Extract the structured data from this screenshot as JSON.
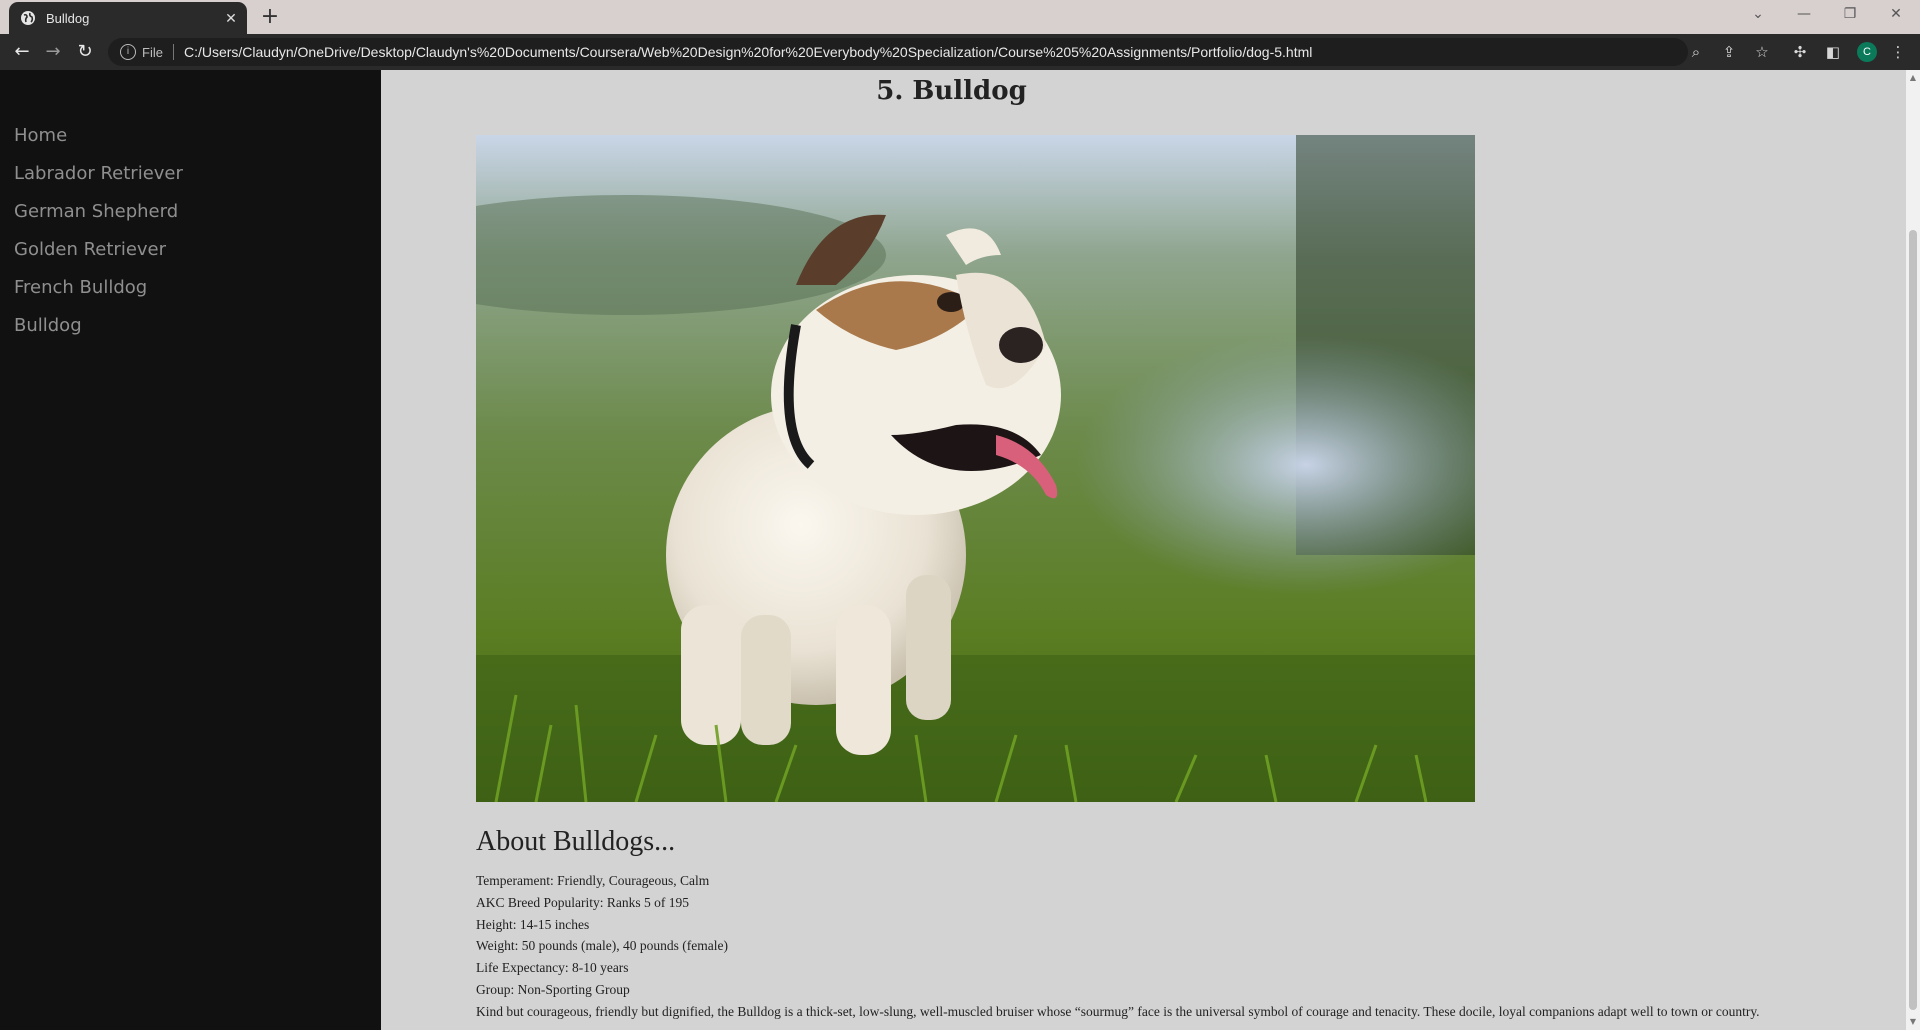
{
  "browser": {
    "tab_title": "Bulldog",
    "omnibox_scheme": "File",
    "url": "C:/Users/Claudyn/OneDrive/Desktop/Claudyn's%20Documents/Coursera/Web%20Design%20for%20Everybody%20Specialization/Course%205%20Assignments/Portfolio/dog-5.html",
    "profile_initial": "C"
  },
  "sidebar": {
    "items": [
      {
        "label": "Home"
      },
      {
        "label": "Labrador Retriever"
      },
      {
        "label": "German Shepherd"
      },
      {
        "label": "Golden Retriever"
      },
      {
        "label": "French Bulldog"
      },
      {
        "label": "Bulldog"
      }
    ]
  },
  "main": {
    "title": "5. Bulldog",
    "about_title": "About Bulldogs...",
    "facts": [
      "Temperament: Friendly, Courageous, Calm",
      "AKC Breed Popularity: Ranks 5 of 195",
      "Height: 14-15 inches",
      "Weight: 50 pounds (male), 40 pounds (female)",
      "Life Expectancy: 8-10 years",
      "Group: Non-Sporting Group",
      "Kind but courageous, friendly but dignified, the Bulldog is a thick-set, low-slung, well-muscled bruiser whose “sourmug” face is the universal symbol of courage and tenacity. These docile, loyal companions adapt well to town or country."
    ]
  },
  "colors": {
    "sidebar_bg": "#111111",
    "page_bg": "#d3d3d3",
    "nav_text": "#8f8f8f",
    "chrome_dark": "#2a2a2a"
  }
}
